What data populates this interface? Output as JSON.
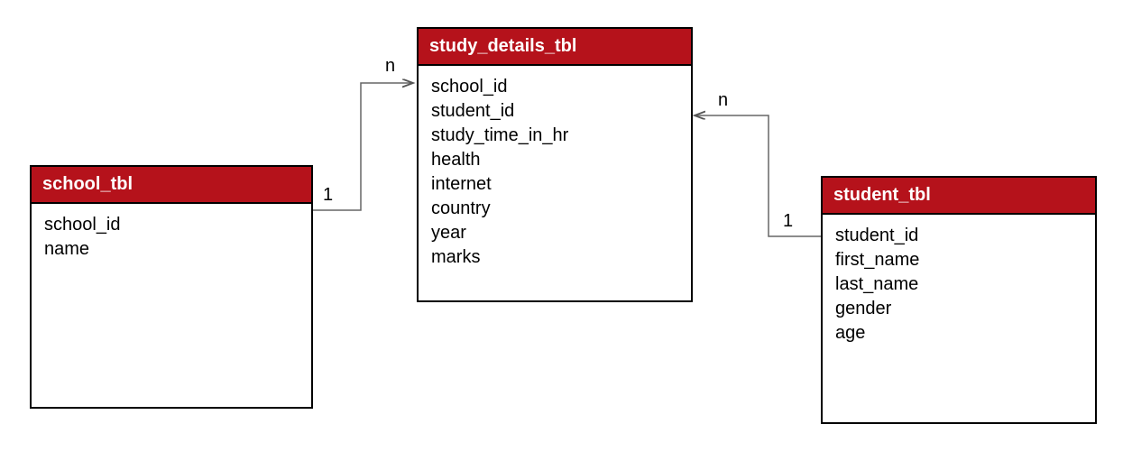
{
  "diagram": {
    "type": "entity-relationship",
    "entities": {
      "school": {
        "title": "school_tbl",
        "fields": [
          "school_id",
          "name"
        ]
      },
      "study_details": {
        "title": "study_details_tbl",
        "fields": [
          "school_id",
          "student_id",
          "study_time_in_hr",
          "health",
          "internet",
          "country",
          "year",
          "marks"
        ]
      },
      "student": {
        "title": "student_tbl",
        "fields": [
          "student_id",
          "first_name",
          "last_name",
          "gender",
          "age"
        ]
      }
    },
    "relationships": {
      "school_to_study": {
        "from_card": "1",
        "to_card": "n"
      },
      "student_to_study": {
        "from_card": "1",
        "to_card": "n"
      }
    }
  }
}
